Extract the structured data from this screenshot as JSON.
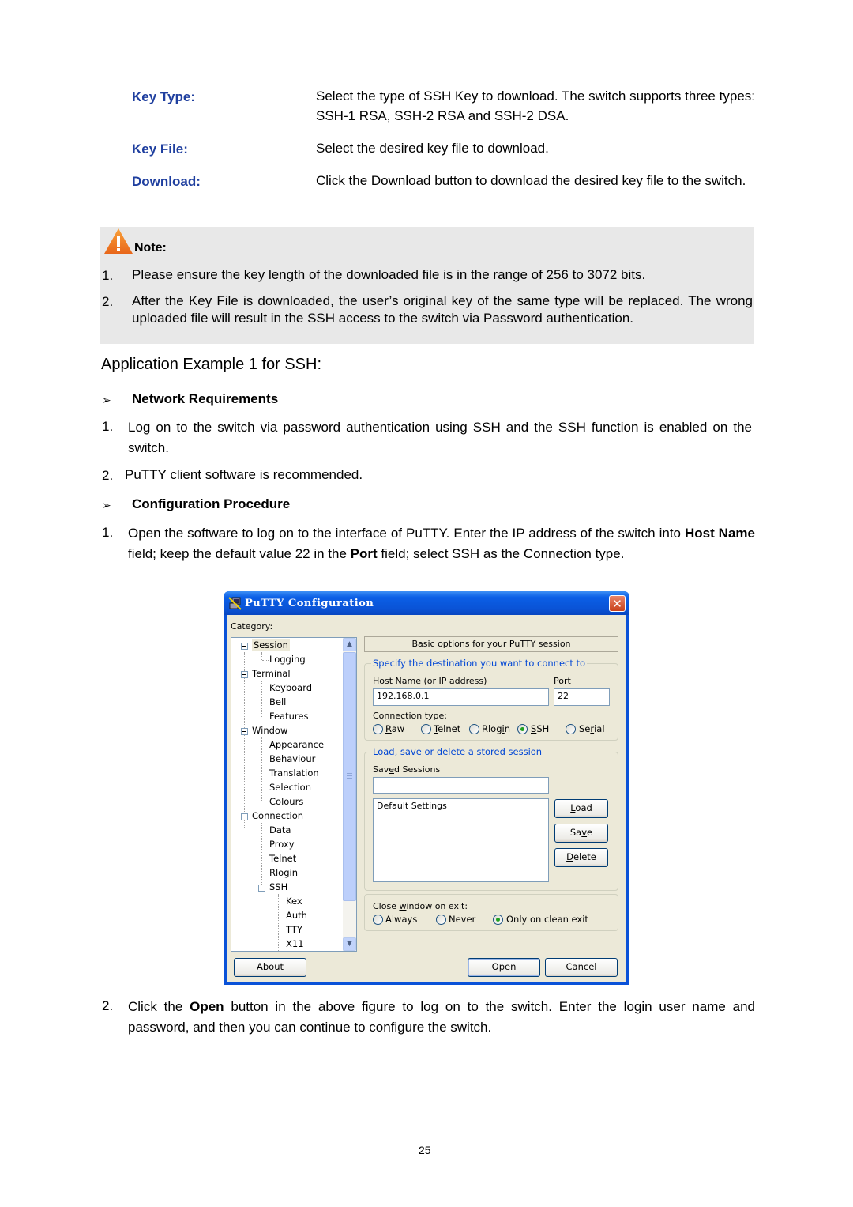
{
  "definitions": [
    {
      "term": "Key Type:",
      "desc": "Select the type of SSH Key to download. The switch supports three types: SSH-1 RSA, SSH-2 RSA and SSH-2 DSA."
    },
    {
      "term": "Key File:",
      "desc": "Select the desired key file to download."
    },
    {
      "term": "Download:",
      "desc": "Click the Download button to download the desired key file to the switch."
    }
  ],
  "note": {
    "icon": "warning-icon",
    "title": "Note:",
    "items": [
      {
        "num": "1.",
        "text": "Please ensure the key length of the downloaded file is in the range of 256 to 3072 bits."
      },
      {
        "num": "2.",
        "text": "After the Key File is downloaded, the user’s original key of the same type will be replaced. The wrong uploaded file will result in the SSH access to the switch via Password authentication."
      }
    ]
  },
  "section_title": "Application Example 1 for SSH:",
  "network_requirements": {
    "heading": "Network Requirements",
    "items": [
      {
        "num": "1.",
        "text": "Log on to the switch via password authentication using SSH and the SSH function is enabled on the switch."
      },
      {
        "num": "2.",
        "text": "PuTTY client software is recommended."
      }
    ]
  },
  "configuration_procedure": {
    "heading": "Configuration Procedure",
    "step1": {
      "num": "1.",
      "part1": "Open the software to log on to the interface of PuTTY. Enter the IP address of the switch into ",
      "bold1": "Host Name",
      "part2": " field; keep the default value 22 in the ",
      "bold2": "Port",
      "part3": " field; select SSH as the Connection type."
    },
    "step2": {
      "num": "2.",
      "part1": "Click the ",
      "bold1": "Open",
      "part2": " button in the above figure to log on to the switch. Enter the login user name and password, and then you can continue to configure the switch."
    }
  },
  "putty": {
    "title": "PuTTY Configuration",
    "close_icon": "✕",
    "category_label": "Category:",
    "tree": [
      {
        "label": "Session",
        "level": 0,
        "expander": true,
        "selected": true
      },
      {
        "label": "Logging",
        "level": 1
      },
      {
        "label": "Terminal",
        "level": 0,
        "expander": true
      },
      {
        "label": "Keyboard",
        "level": 1
      },
      {
        "label": "Bell",
        "level": 1
      },
      {
        "label": "Features",
        "level": 1
      },
      {
        "label": "Window",
        "level": 0,
        "expander": true
      },
      {
        "label": "Appearance",
        "level": 1
      },
      {
        "label": "Behaviour",
        "level": 1
      },
      {
        "label": "Translation",
        "level": 1
      },
      {
        "label": "Selection",
        "level": 1
      },
      {
        "label": "Colours",
        "level": 1
      },
      {
        "label": "Connection",
        "level": 0,
        "expander": true
      },
      {
        "label": "Data",
        "level": 1
      },
      {
        "label": "Proxy",
        "level": 1
      },
      {
        "label": "Telnet",
        "level": 1
      },
      {
        "label": "Rlogin",
        "level": 1
      },
      {
        "label": "SSH",
        "level": 1,
        "expander": true
      },
      {
        "label": "Kex",
        "level": 2
      },
      {
        "label": "Auth",
        "level": 2
      },
      {
        "label": "TTY",
        "level": 2
      },
      {
        "label": "X11",
        "level": 2
      }
    ],
    "banner": "Basic options for your PuTTY session",
    "destination_group": "Specify the destination you want to connect to",
    "host_label_pre": "Host ",
    "host_label_u": "N",
    "host_label_post": "ame (or IP address)",
    "host_value": "192.168.0.1",
    "port_label_u": "P",
    "port_label_post": "ort",
    "port_value": "22",
    "connection_type_label": "Connection type:",
    "connection_types": [
      {
        "u": "R",
        "rest": "aw",
        "selected": false
      },
      {
        "u": "T",
        "rest": "elnet",
        "selected": false
      },
      {
        "pre": "Rlog",
        "u": "i",
        "rest": "n",
        "selected": false
      },
      {
        "u": "S",
        "rest": "SH",
        "selected": true
      },
      {
        "pre": "Se",
        "u": "r",
        "rest": "ial",
        "selected": false
      }
    ],
    "session_group": "Load, save or delete a stored session",
    "saved_sessions_pre": "Sav",
    "saved_sessions_u": "e",
    "saved_sessions_post": "d Sessions",
    "saved_sessions_value": "",
    "sessions_list": [
      "Default Settings"
    ],
    "load_u": "L",
    "load_rest": "oad",
    "save_pre": "Sa",
    "save_u": "v",
    "save_rest": "e",
    "delete_u": "D",
    "delete_rest": "elete",
    "close_label_pre": "Close ",
    "close_label_u": "w",
    "close_label_post": "indow on exit:",
    "close_options": [
      {
        "label": "Always",
        "selected": false
      },
      {
        "label": "Never",
        "selected": false
      },
      {
        "label": "Only on clean exit",
        "selected": true
      }
    ],
    "about_u": "A",
    "about_rest": "bout",
    "open_u": "O",
    "open_rest": "pen",
    "cancel_u": "C",
    "cancel_rest": "ancel"
  },
  "page_number": "25"
}
